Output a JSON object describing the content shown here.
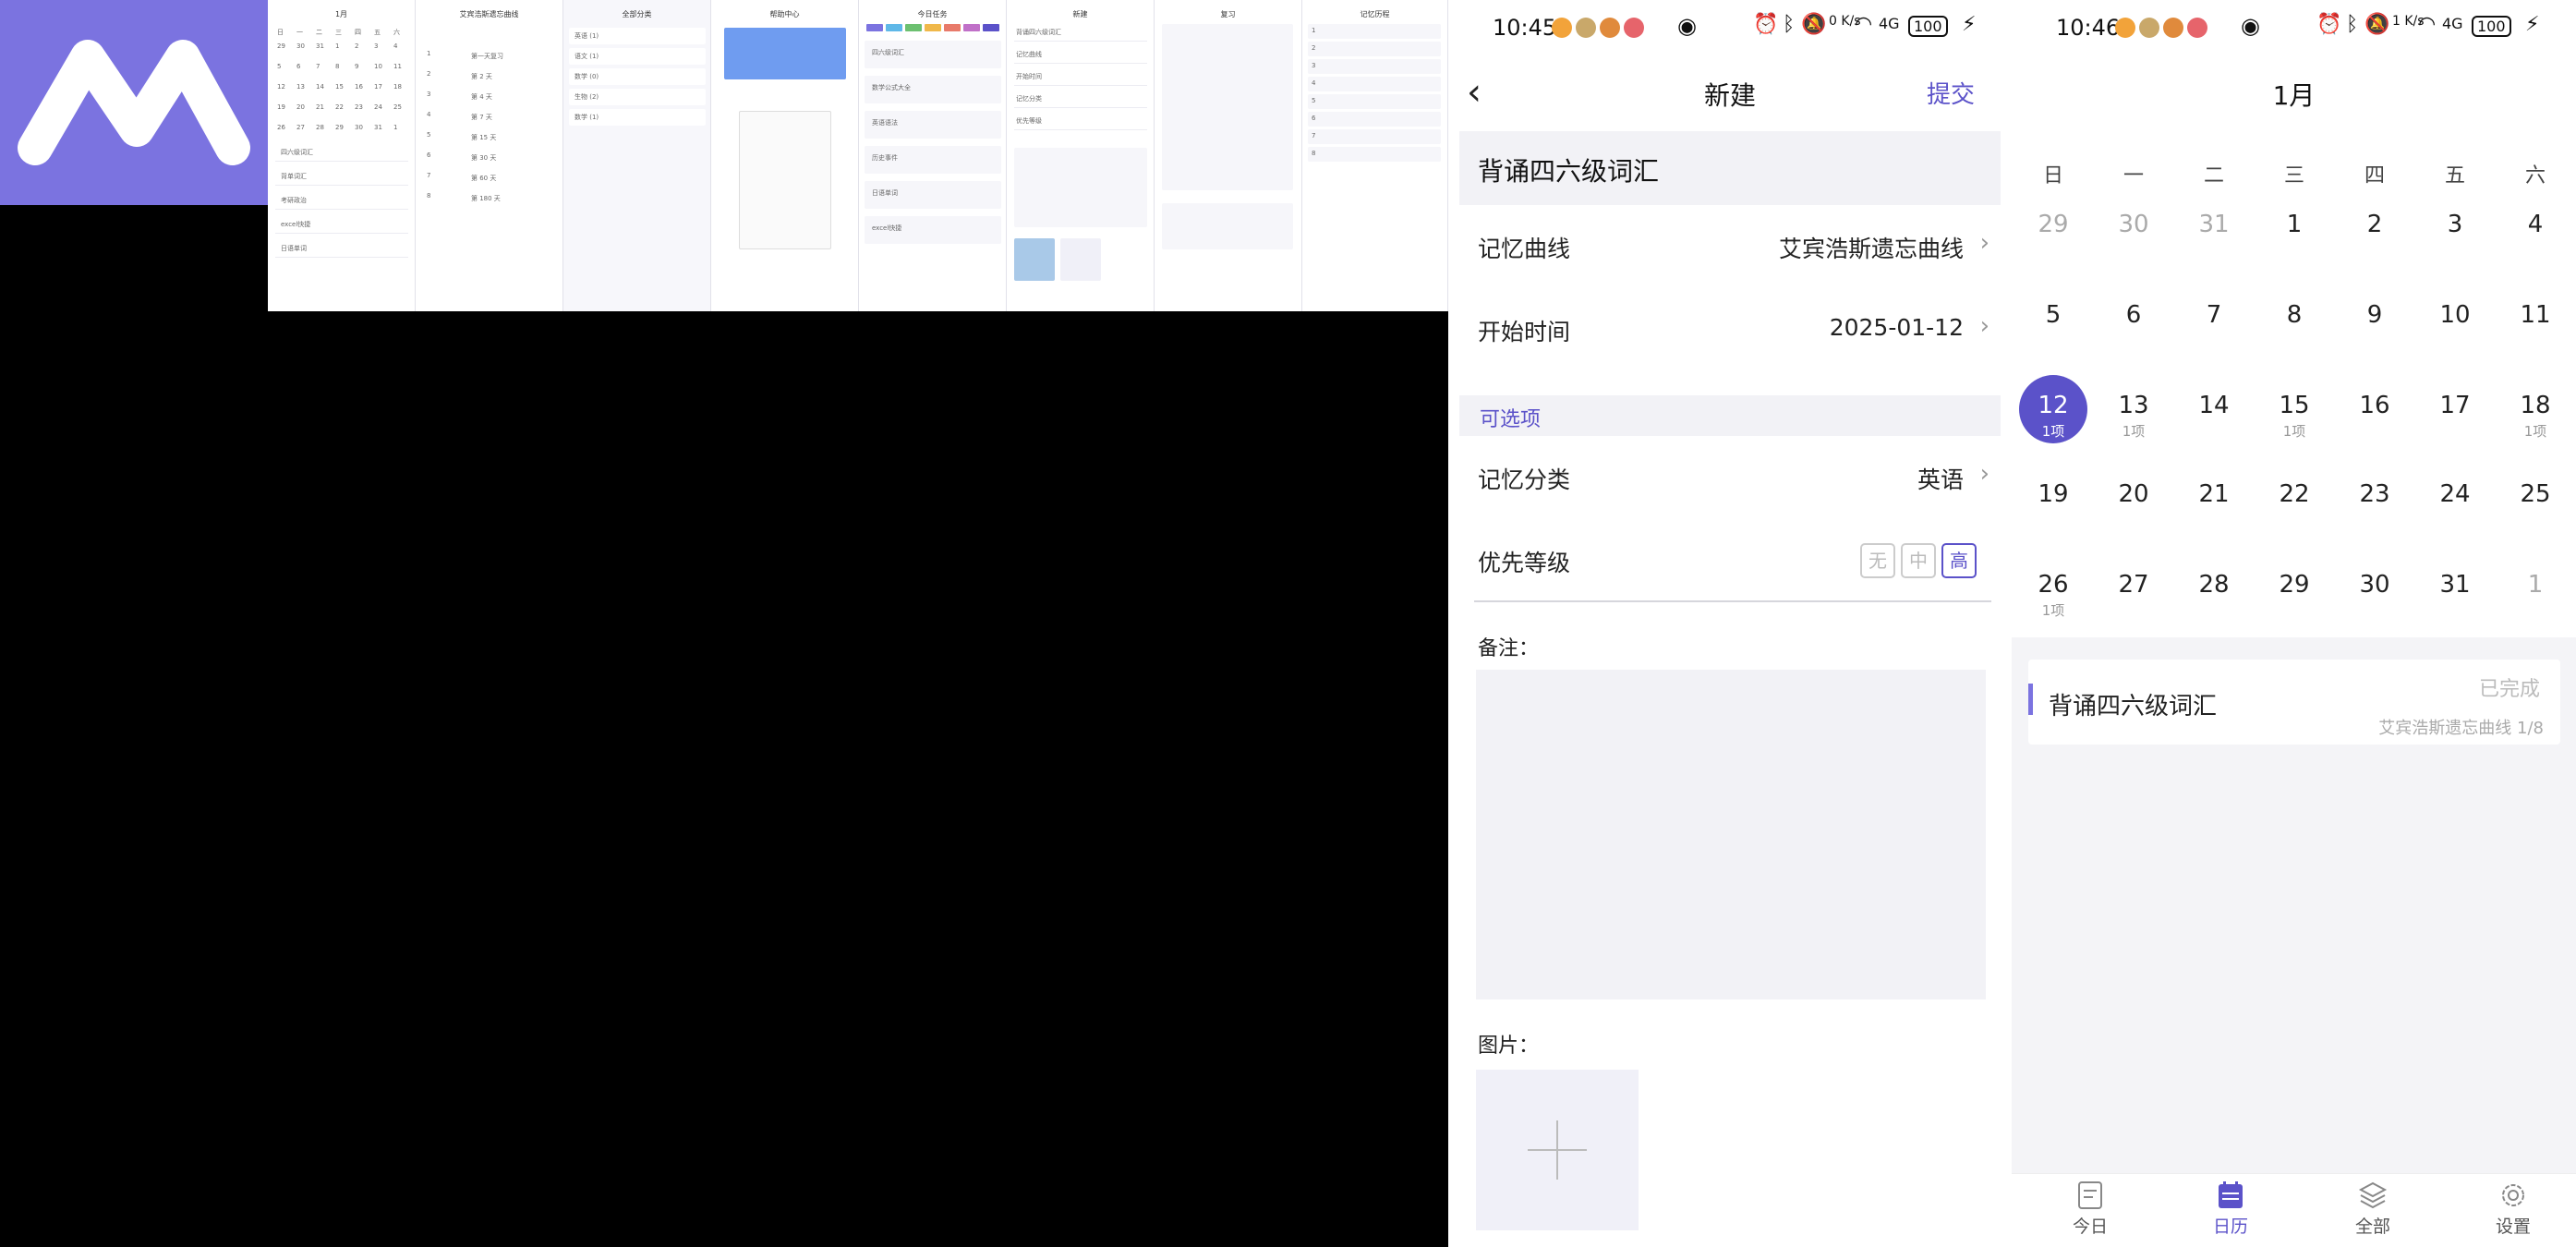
{
  "collage": {
    "calendar": {
      "month": "1月",
      "weekdays": [
        "日",
        "一",
        "二",
        "三",
        "四",
        "五",
        "六"
      ],
      "rows": [
        [
          "29",
          "30",
          "31",
          "1",
          "2",
          "3",
          "4"
        ],
        [
          "5",
          "6",
          "7",
          "8",
          "9",
          "10",
          "11"
        ],
        [
          "12",
          "13",
          "14",
          "15",
          "16",
          "17",
          "18"
        ],
        [
          "19",
          "20",
          "21",
          "22",
          "23",
          "24",
          "25"
        ],
        [
          "26",
          "27",
          "28",
          "29",
          "30",
          "31",
          "1"
        ]
      ],
      "list": [
        "四六级词汇",
        "背单词汇",
        "考研政治",
        "excel快捷",
        "日语单词"
      ]
    },
    "curve": {
      "title": "艾宾浩斯遗忘曲线",
      "items": [
        "第一天复习",
        "第 2 天",
        "第 4 天",
        "第 7 天",
        "第 15 天",
        "第 30 天",
        "第 60 天",
        "第 180 天"
      ]
    },
    "categories": {
      "title": "全部分类",
      "items": [
        "英语 (1)",
        "语文 (1)",
        "数学 (0)",
        "生物 (2)",
        "数学 (1)"
      ]
    },
    "help": {
      "title": "帮助中心"
    },
    "today": {
      "title": "今日任务",
      "items": [
        "四六级词汇",
        "数学公式大全",
        "英语语法",
        "历史事件",
        "日语单词",
        "excel快捷"
      ]
    },
    "new": {
      "title": "新建",
      "rows": [
        "背诵四六级词汇",
        "记忆曲线",
        "开始时间",
        "记忆分类",
        "优先等级"
      ]
    },
    "review": {
      "title": "复习"
    },
    "records": {
      "title": "记忆历程",
      "items": [
        "1",
        "2",
        "3",
        "4",
        "5",
        "6",
        "7",
        "8"
      ]
    }
  },
  "status1": {
    "time": "10:45",
    "battery": "100",
    "net": "4G",
    "speed": "0 K/s"
  },
  "status2": {
    "time": "10:46",
    "battery": "100",
    "net": "4G",
    "speed": "1 K/s"
  },
  "new_form": {
    "title": "新建",
    "submit": "提交",
    "name": "背诵四六级词汇",
    "curve_label": "记忆曲线",
    "curve_value": "艾宾浩斯遗忘曲线",
    "start_label": "开始时间",
    "start_value": "2025-01-12",
    "optional": "可选项",
    "category_label": "记忆分类",
    "category_value": "英语",
    "priority_label": "优先等级",
    "priority": [
      "无",
      "中",
      "高"
    ],
    "priority_selected": "高",
    "notes_label": "备注：",
    "image_label": "图片："
  },
  "calendar": {
    "month": "1月",
    "weekdays": [
      "日",
      "一",
      "二",
      "三",
      "四",
      "五",
      "六"
    ],
    "days": [
      {
        "n": "29",
        "gray": true
      },
      {
        "n": "30",
        "gray": true
      },
      {
        "n": "31",
        "gray": true
      },
      {
        "n": "1"
      },
      {
        "n": "2"
      },
      {
        "n": "3"
      },
      {
        "n": "4"
      },
      {
        "n": "5"
      },
      {
        "n": "6"
      },
      {
        "n": "7"
      },
      {
        "n": "8"
      },
      {
        "n": "9"
      },
      {
        "n": "10"
      },
      {
        "n": "11"
      },
      {
        "n": "12",
        "sub": "1项",
        "sel": true
      },
      {
        "n": "13",
        "sub": "1项"
      },
      {
        "n": "14"
      },
      {
        "n": "15",
        "sub": "1项"
      },
      {
        "n": "16"
      },
      {
        "n": "17"
      },
      {
        "n": "18",
        "sub": "1项"
      },
      {
        "n": "19"
      },
      {
        "n": "20"
      },
      {
        "n": "21"
      },
      {
        "n": "22"
      },
      {
        "n": "23"
      },
      {
        "n": "24"
      },
      {
        "n": "25"
      },
      {
        "n": "26",
        "sub": "1项"
      },
      {
        "n": "27"
      },
      {
        "n": "28"
      },
      {
        "n": "29"
      },
      {
        "n": "30"
      },
      {
        "n": "31"
      },
      {
        "n": "1",
        "gray": true
      }
    ],
    "task": {
      "name": "背诵四六级词汇",
      "status": "已完成",
      "meta": "艾宾浩斯遗忘曲线 1/8"
    },
    "tabs": [
      {
        "label": "今日",
        "icon": "today-icon"
      },
      {
        "label": "日历",
        "icon": "calendar-icon",
        "active": true
      },
      {
        "label": "全部",
        "icon": "layers-icon"
      },
      {
        "label": "设置",
        "icon": "gear-icon"
      }
    ]
  },
  "colors": {
    "accent": "#5b52c9",
    "logo_bg": "#7b73e0"
  }
}
